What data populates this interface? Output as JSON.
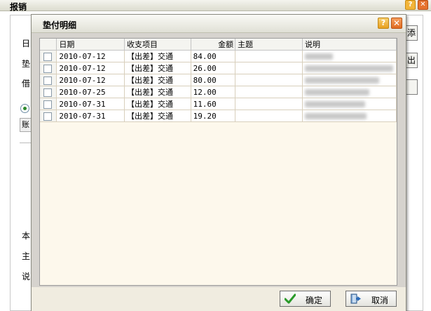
{
  "background_window": {
    "title": "报销",
    "labels": [
      "日",
      "垫",
      "借",
      "本",
      "主",
      "说"
    ],
    "tab_label": "账",
    "side_buttons": [
      "添",
      "出",
      ""
    ]
  },
  "dialog": {
    "title": "垫付明细",
    "columns": [
      "日期",
      "收支项目",
      "金额",
      "主题",
      "说明"
    ],
    "rows": [
      {
        "date": "2010-07-12",
        "item": "【出差】交通",
        "amount": "84.00",
        "subject": "",
        "note": ""
      },
      {
        "date": "2010-07-12",
        "item": "【出差】交通",
        "amount": "26.00",
        "subject": "",
        "note": ""
      },
      {
        "date": "2010-07-12",
        "item": "【出差】交通",
        "amount": "80.00",
        "subject": "",
        "note": ""
      },
      {
        "date": "2010-07-25",
        "item": "【出差】交通",
        "amount": "12.00",
        "subject": "",
        "note": ""
      },
      {
        "date": "2010-07-31",
        "item": "【出差】交通",
        "amount": "11.60",
        "subject": "",
        "note": ""
      },
      {
        "date": "2010-07-31",
        "item": "【出差】交通",
        "amount": "19.20",
        "subject": "",
        "note": ""
      }
    ],
    "ok_label": "确定",
    "cancel_label": "取消"
  },
  "colors": {
    "grid_background": "#fdf8ec",
    "ok_icon": "#2a9a2a",
    "help_icon": "#e8a020",
    "close_icon": "#e06a20"
  },
  "icons": [
    "help-icon",
    "close-icon",
    "checkmark-icon",
    "exit-door-icon",
    "radio-selected-icon"
  ]
}
